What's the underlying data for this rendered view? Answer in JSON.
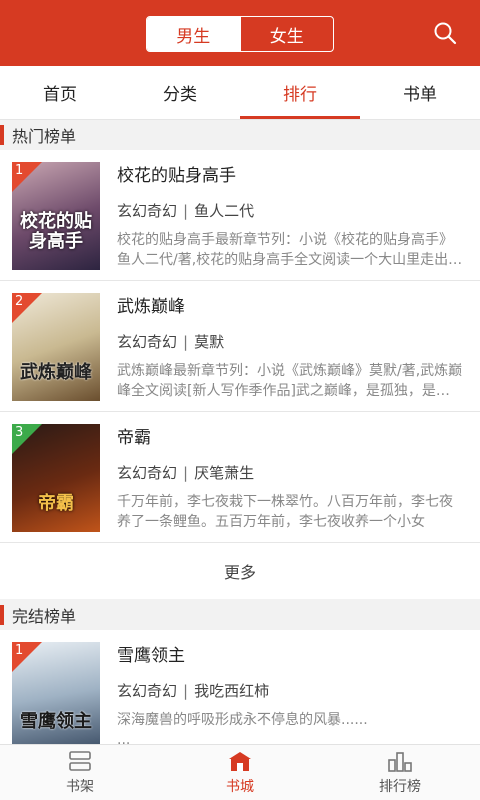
{
  "header": {
    "gender_tabs": [
      "男生",
      "女生"
    ],
    "active_gender": "男生"
  },
  "tabs": [
    "首页",
    "分类",
    "排行",
    "书单"
  ],
  "active_tab": "排行",
  "sections": [
    {
      "title": "热门榜单",
      "books": [
        {
          "rank": "1",
          "title": "校花的贴身高手",
          "genre": "玄幻奇幻",
          "author": "鱼人二代",
          "desc": "校花的贴身高手最新章节列：小说《校花的贴身高手》鱼人二代/著,校花的贴身高手全文阅读一个大山里走出…",
          "cover_text": "校花的贴身高手",
          "cover_color": "#9a7a8a"
        },
        {
          "rank": "2",
          "title": "武炼巅峰",
          "genre": "玄幻奇幻",
          "author": "莫默",
          "desc": "武炼巅峰最新章节列：小说《武炼巅峰》莫默/著,武炼巅峰全文阅读[新人写作季作品]武之巅峰，是孤独，是…",
          "cover_text": "武炼巅峰",
          "cover_color": "#cfc7b4"
        },
        {
          "rank": "3",
          "title": "帝霸",
          "genre": "玄幻奇幻",
          "author": "厌笔萧生",
          "desc": "千万年前，李七夜栽下一株翠竹。八百万年前，李七夜养了一条鲤鱼。五百万年前，李七夜收养一个小女孩。…",
          "cover_text": "帝霸",
          "cover_color": "#3a1c12"
        }
      ],
      "more_label": "更多"
    },
    {
      "title": "完结榜单",
      "books": [
        {
          "rank": "1",
          "title": "雪鹰领主",
          "genre": "玄幻奇幻",
          "author": "我吃西红柿",
          "desc": "深海魔兽的呼吸形成永不停息的风暴......\n...",
          "cover_text": "雪鹰领主",
          "cover_color": "#8aa0b8"
        }
      ]
    }
  ],
  "bottom_nav": [
    {
      "label": "书架",
      "icon": "bookshelf-icon"
    },
    {
      "label": "书城",
      "icon": "bookstore-icon"
    },
    {
      "label": "排行榜",
      "icon": "ranking-icon"
    }
  ],
  "active_nav": "书城",
  "colors": {
    "accent": "#d63a22",
    "rank1": "#e34a2f",
    "rank2": "#e34a2f",
    "rank3": "#3caa4a"
  }
}
